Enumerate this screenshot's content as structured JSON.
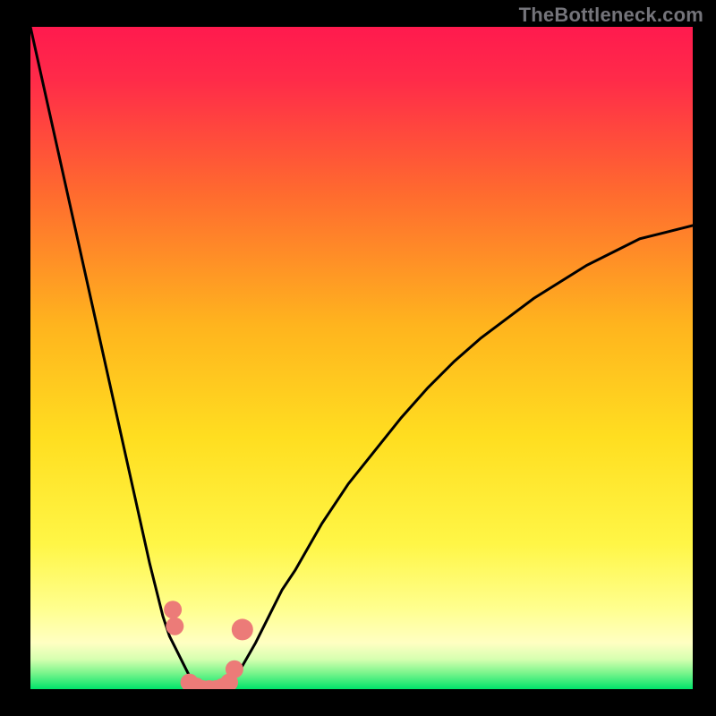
{
  "watermark": "TheBottleneck.com",
  "colors": {
    "frame": "#000000",
    "gradient_top": "#ff1a4e",
    "gradient_mid": "#ffd500",
    "gradient_low": "#ffff90",
    "gradient_bottom": "#00e46a",
    "curve": "#000000",
    "markers": "#ec7b78"
  },
  "chart_data": {
    "type": "line",
    "title": "",
    "xlabel": "",
    "ylabel": "",
    "xlim": [
      0,
      100
    ],
    "ylim": [
      0,
      100
    ],
    "x": [
      0,
      2,
      4,
      6,
      8,
      10,
      12,
      14,
      16,
      18,
      19,
      20,
      21,
      22,
      23,
      24,
      25,
      26,
      27,
      28,
      29,
      30,
      31,
      32,
      34,
      36,
      38,
      40,
      44,
      48,
      52,
      56,
      60,
      64,
      68,
      72,
      76,
      80,
      84,
      88,
      92,
      96,
      100
    ],
    "values": [
      100,
      91,
      82,
      73,
      64,
      55,
      46,
      37,
      28,
      19,
      15,
      11,
      8,
      6,
      4,
      2,
      1,
      0,
      0,
      0,
      0.5,
      1,
      2,
      3.5,
      7,
      11,
      15,
      18,
      25,
      31,
      36,
      41,
      45.5,
      49.5,
      53,
      56,
      59,
      61.5,
      64,
      66,
      68,
      69,
      70
    ],
    "markers": {
      "x": [
        21.5,
        21.8,
        24,
        25,
        26,
        27,
        28,
        29,
        30,
        30.8,
        32
      ],
      "y": [
        12,
        9.5,
        1,
        0.4,
        0,
        0,
        0,
        0.3,
        1,
        3,
        9
      ],
      "size": [
        10,
        10,
        10,
        10,
        10,
        10,
        10,
        10,
        10,
        10,
        12
      ]
    }
  }
}
